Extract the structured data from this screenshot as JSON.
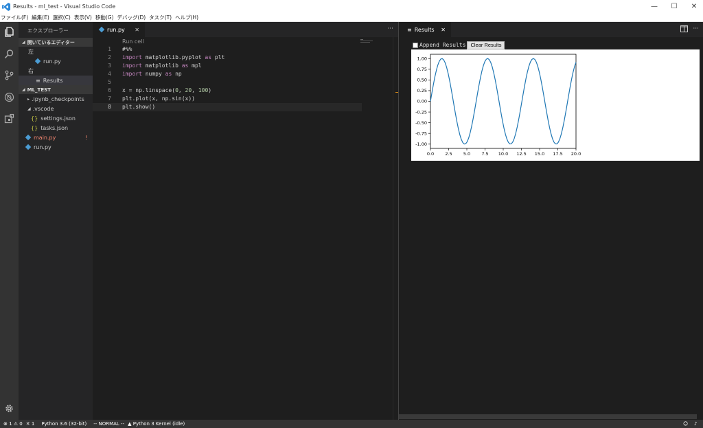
{
  "window": {
    "title": "Results - ml_test - Visual Studio Code",
    "controls": {
      "minimize": "—",
      "maximize": "☐",
      "close": "✕"
    }
  },
  "menu": [
    "ファイル(F)",
    "編集(E)",
    "選択(C)",
    "表示(V)",
    "移動(G)",
    "デバッグ(D)",
    "タスク(T)",
    "ヘルプ(H)"
  ],
  "activity_icons": [
    "files-icon",
    "search-icon",
    "source-control-icon",
    "debug-icon",
    "extensions-icon",
    "gear-icon"
  ],
  "sidebar": {
    "title": "エクスプローラー",
    "open_editors": {
      "header": "開いているエディター",
      "group_left": "左",
      "left_file": "run.py",
      "group_right": "右",
      "right_file": "Results"
    },
    "workspace": {
      "header": "ML_TEST",
      "items": {
        "checkpoints": ".ipynb_checkpoints",
        "vscode": ".vscode",
        "settings": "settings.json",
        "tasks": "tasks.json",
        "main": "main.py",
        "main_badge": "!",
        "run": "run.py"
      }
    }
  },
  "editor1": {
    "tab_label": "run.py",
    "codelens": "Run cell",
    "line_numbers": [
      "1",
      "2",
      "3",
      "4",
      "5",
      "6",
      "7",
      "8"
    ],
    "code": {
      "l1": "#%%",
      "l2": {
        "kw1": "import",
        "mod": " matplotlib.pyplot ",
        "kw2": "as",
        "alias": " plt"
      },
      "l3": {
        "kw1": "import",
        "mod": " matplotlib ",
        "kw2": "as",
        "alias": " mpl"
      },
      "l4": {
        "kw1": "import",
        "mod": " numpy ",
        "kw2": "as",
        "alias": " np"
      },
      "l6": {
        "a": "x = np.linspace(",
        "n1": "0",
        "s1": ", ",
        "n2": "20",
        "s2": ", ",
        "n3": "100",
        "e": ")"
      },
      "l7": "plt.plot(x, np.sin(x))",
      "l8": "plt.show()"
    }
  },
  "editor2": {
    "tab_label": "Results",
    "append_label": "Append Results",
    "clear_label": "Clear Results"
  },
  "chart_data": {
    "type": "line",
    "x_range": [
      0,
      20
    ],
    "ylim": [
      -1.1,
      1.1
    ],
    "xticks": [
      "0.0",
      "2.5",
      "5.0",
      "7.5",
      "10.0",
      "12.5",
      "15.0",
      "17.5",
      "20.0"
    ],
    "yticks": [
      "1.00",
      "0.75",
      "0.50",
      "0.25",
      "0.00",
      "-0.25",
      "-0.50",
      "-0.75",
      "-1.00"
    ],
    "color": "#1f77b4",
    "series": [
      {
        "function": "sin(x)",
        "points": 100
      }
    ]
  },
  "statusbar": {
    "errors": "1",
    "warnings": "0",
    "tools": "1",
    "python": "Python 3.6 (32-bit)",
    "mode": "-- NORMAL --",
    "kernel": "Python 3 Kernel (idle)"
  }
}
